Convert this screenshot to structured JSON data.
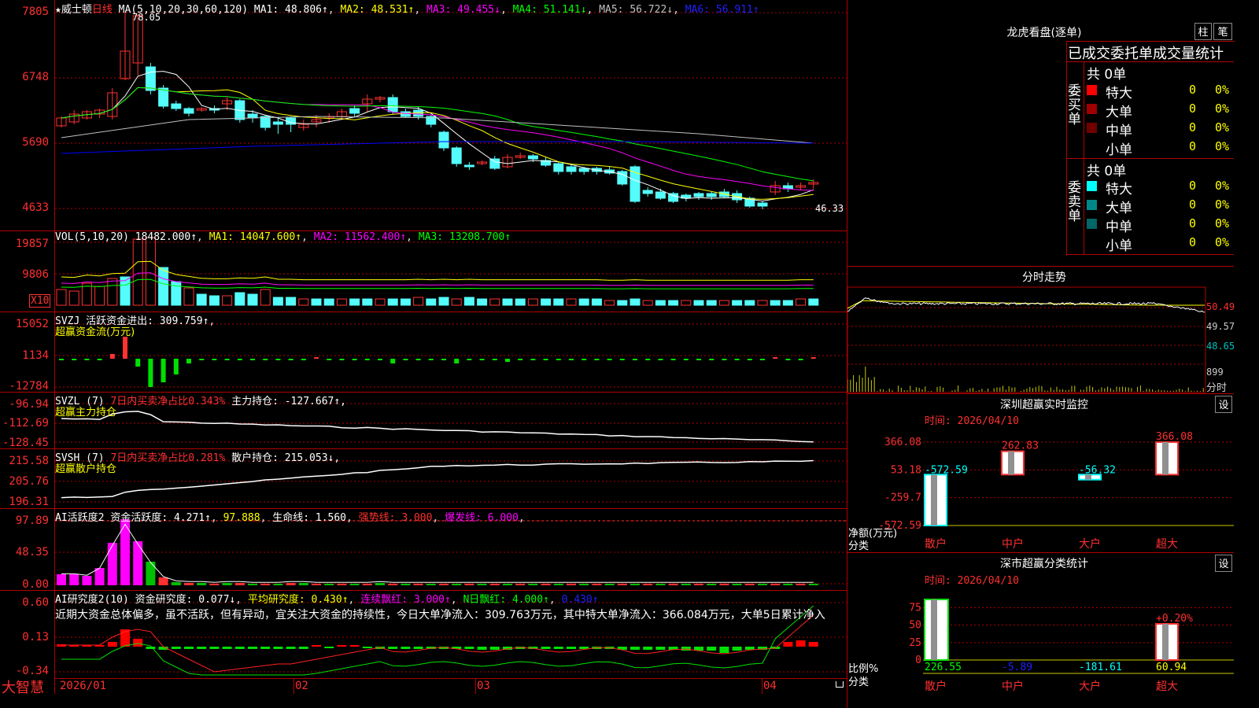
{
  "colors": {
    "bg": "#000000",
    "grid": "#b00000",
    "up": "#ff3232",
    "down": "#54fcfc",
    "ma1": "#ffffff",
    "ma2": "#ffff00",
    "ma3": "#ff00ff",
    "ma4": "#00ff00",
    "ma5": "#c0c0c0",
    "ma6": "#0000ff"
  },
  "main": {
    "stock_name": "★威士顿",
    "period_label": "日线",
    "ma_title": "MA(5,10,20,30,60,120)",
    "ma": [
      {
        "label": "MA1: 48.806↑",
        "color": "#ffffff"
      },
      {
        "label": "MA2: 48.531↑",
        "color": "#ffff00"
      },
      {
        "label": "MA3: 49.455↓",
        "color": "#ff00ff"
      },
      {
        "label": "MA4: 51.141↓",
        "color": "#00ff00"
      },
      {
        "label": "MA5: 56.722↓",
        "color": "#c0c0c0"
      },
      {
        "label": "MA6: 56.911↑",
        "color": "#2020ff"
      }
    ],
    "y_labels": [
      "7805",
      "6748",
      "5690",
      "4633"
    ],
    "high_mark": "78.05",
    "low_mark": "46.33"
  },
  "vol": {
    "title": "VOL(5,10,20)",
    "value": "18482.000↑",
    "ma1": "MA1: 14047.600↑",
    "ma2": "MA2: 11562.400↑",
    "ma3": "MA3: 13208.700↑",
    "y_labels": [
      "19857",
      "9806"
    ],
    "unit": "X10"
  },
  "svzj": {
    "title": "SVZJ",
    "label": "活跃资金进出: 309.759↑",
    "sub": "超赢资金流(万元)",
    "y_labels": [
      "15052",
      "1134",
      "-12784"
    ]
  },
  "svzl": {
    "title": "SVZL (7)",
    "pct": "7日内买卖净占比0.343%",
    "hold": "主力持仓: -127.667↑,",
    "sub": "超赢主力持仓",
    "y_labels": [
      "-96.94",
      "-112.69",
      "-128.45"
    ]
  },
  "svsh": {
    "title": "SVSH (7)",
    "pct": "7日内买卖净占比0.281%",
    "hold": "散户持仓: 215.053↓,",
    "sub": "超赢散户持仓",
    "y_labels": [
      "215.58",
      "205.76",
      "196.31"
    ]
  },
  "ai_active": {
    "title": "AI活跃度2",
    "v1": "资金活跃度: 4.271↑",
    "v2": "97.888",
    "v3": "生命线: 1.560",
    "v4": "强势线: 3.000",
    "v5": "爆发线: 6.000",
    "y_labels": [
      "97.89",
      "48.35",
      "0.00"
    ]
  },
  "ai_research": {
    "title": "AI研究度2(10)",
    "v1": "资金研究度: 0.077↓",
    "v2": "平均研究度: 0.430↑",
    "v3": "连续飘红: 3.000↑",
    "v4": "N日飘红: 4.000↑",
    "v5": "0.430↑",
    "text": "近期大资金总体偏多，虽不活跃，但有异动，宜关注大资金的持续性，今日大单净流入：309.763万元，其中特大单净流入：366.084万元，大单5日累计净入",
    "y_labels": [
      "0.60",
      "0.13",
      "-0.34"
    ]
  },
  "x_axis": {
    "labels": [
      "2026/01",
      "02",
      "03",
      "04"
    ]
  },
  "footer": {
    "logo": "大智慧"
  },
  "right": {
    "dragon": {
      "title": "龙虎看盘(逐单)",
      "btn1": "柱",
      "btn2": "笔",
      "header": "已成交委托单成交量统计",
      "buy_side": "委买单",
      "sell_side": "委卖单",
      "buy_total": "共 0单",
      "sell_total": "共 0单",
      "buy_rows": [
        {
          "label": "特大",
          "count": "0",
          "pct": "0%",
          "color": "#ff0000"
        },
        {
          "label": "大单",
          "count": "0",
          "pct": "0%",
          "color": "#a00000"
        },
        {
          "label": "中单",
          "count": "0",
          "pct": "0%",
          "color": "#700000"
        },
        {
          "label": "小单",
          "count": "0",
          "pct": "0%",
          "color": ""
        }
      ],
      "sell_rows": [
        {
          "label": "特大",
          "count": "0",
          "pct": "0%",
          "color": "#00ffff"
        },
        {
          "label": "大单",
          "count": "0",
          "pct": "0%",
          "color": "#008888"
        },
        {
          "label": "中单",
          "count": "0",
          "pct": "0%",
          "color": "#006666"
        },
        {
          "label": "小单",
          "count": "0",
          "pct": "0%",
          "color": ""
        }
      ]
    },
    "intraday": {
      "title": "分时走势",
      "y_labels": [
        "50.49",
        "49.57",
        "48.65"
      ],
      "vol_label": "899",
      "unit": "分时"
    },
    "monitor": {
      "title": "深圳超赢实时监控",
      "btn": "设",
      "time": "时间: 2026/04/10",
      "y_labels": [
        "366.08",
        "53.18",
        "-259.7",
        "-572.59"
      ],
      "net_label": "净额(万元)",
      "cat_label": "分类",
      "bars": [
        {
          "cat": "散户",
          "value": -572.59,
          "label": "-572.59"
        },
        {
          "cat": "中户",
          "value": 262.83,
          "label": "262.83"
        },
        {
          "cat": "大户",
          "value": -56.32,
          "label": "-56.32"
        },
        {
          "cat": "超大",
          "value": 366.08,
          "label": "366.08"
        }
      ]
    },
    "stats": {
      "title": "深市超赢分类统计",
      "btn": "设",
      "time": "时间: 2026/04/10",
      "y_labels": [
        "75",
        "50",
        "25",
        "0"
      ],
      "ratio_label": "比例%",
      "cat_label": "分类",
      "pct_label": "+0.20%",
      "values": [
        "226.55",
        "-5.89",
        "-181.61",
        "60.94"
      ],
      "cats": [
        "散户",
        "中户",
        "大户",
        "超大"
      ]
    }
  }
}
